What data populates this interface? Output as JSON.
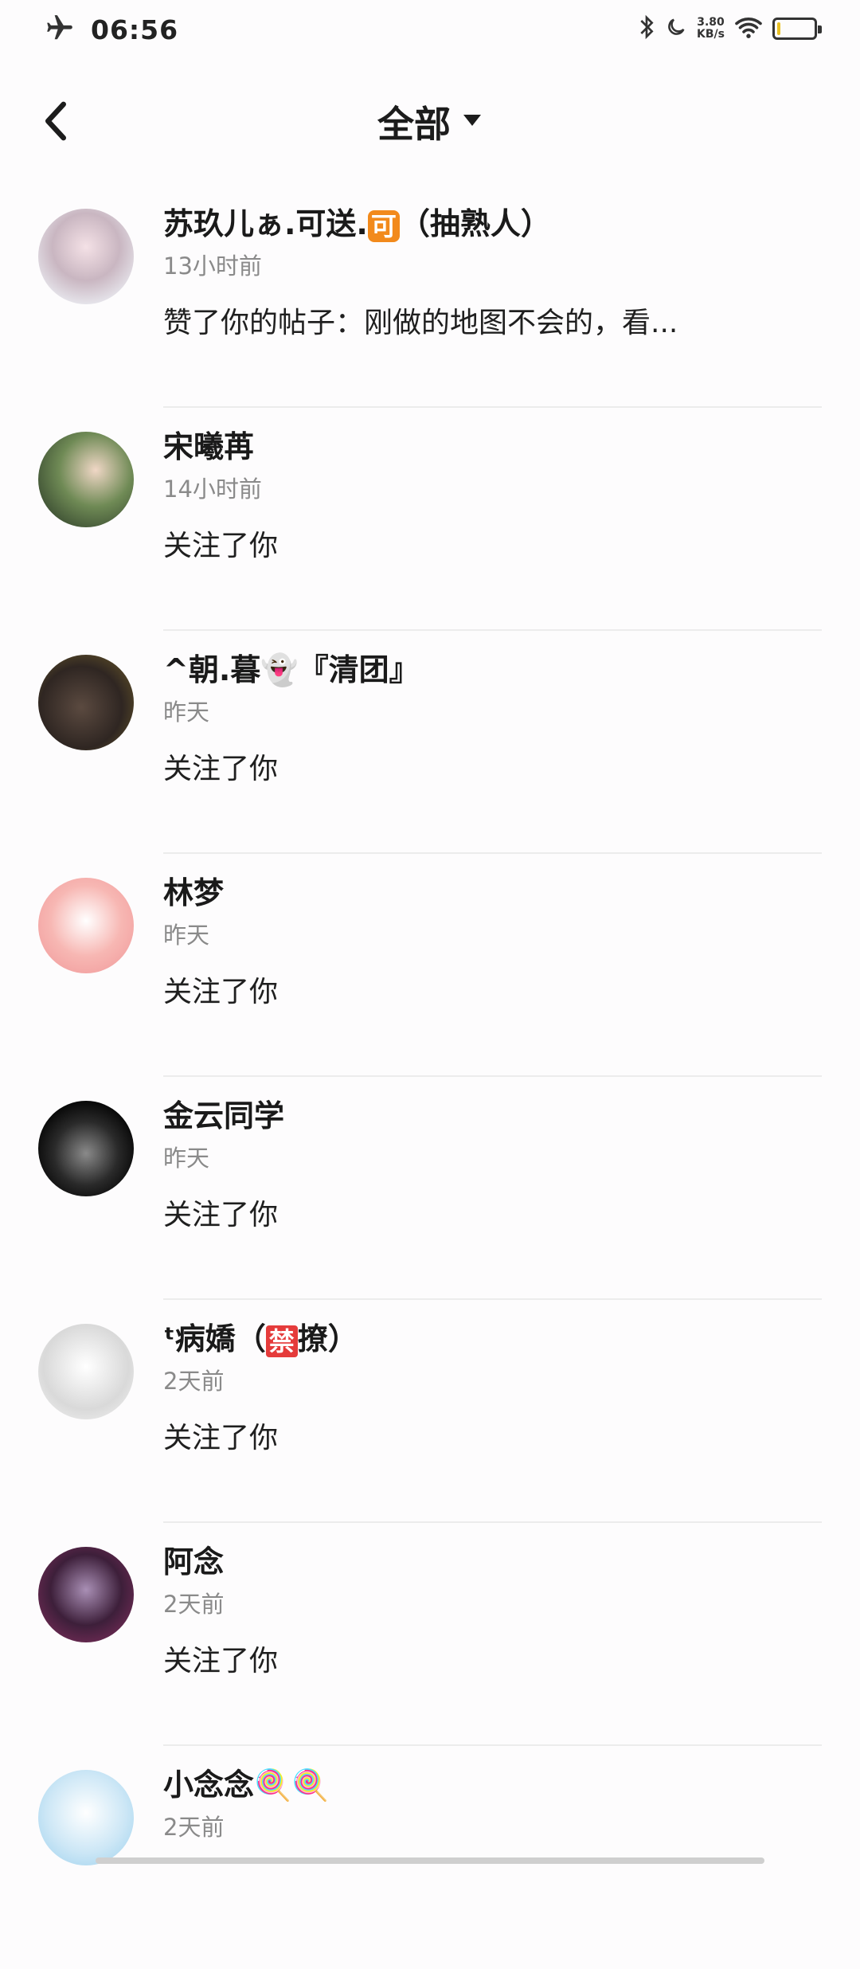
{
  "status_bar": {
    "time": "06:56",
    "net_speed_value": "3.80",
    "net_speed_unit": "KB/s",
    "battery_level_percent": 10,
    "icons": [
      "airplane-icon",
      "bluetooth-icon",
      "moon-icon",
      "wifi-icon",
      "battery-icon"
    ]
  },
  "header": {
    "title": "全部",
    "back_icon": "chevron-left-icon",
    "dropdown_icon": "caret-down-icon"
  },
  "notifications": [
    {
      "name": "苏玖儿ぁ.可送.",
      "badge": "可",
      "name_suffix": "（抽熟人）",
      "time": "13小时前",
      "message": "赞了你的帖子：刚做的地图不会的，看..."
    },
    {
      "name": "宋曦苒",
      "time": "14小时前",
      "message": "关注了你"
    },
    {
      "name": "^朝.暮👻『清团』",
      "time": "昨天",
      "message": "关注了你"
    },
    {
      "name": "林梦",
      "time": "昨天",
      "message": "关注了你"
    },
    {
      "name": "金云同学",
      "time": "昨天",
      "message": "关注了你"
    },
    {
      "name": "ᵗ病嬌（",
      "badge": "禁",
      "name_suffix": "撩）",
      "time": "2天前",
      "message": "关注了你"
    },
    {
      "name": "阿念",
      "time": "2天前",
      "message": "关注了你"
    },
    {
      "name": "小念念🍭🍭",
      "time": "2天前",
      "message": ""
    }
  ],
  "colors": {
    "background": "#fdfcfd",
    "divider": "#ececec",
    "badge_orange": "#f28a1c",
    "badge_red": "#e53b3b",
    "battery_fill": "#e9c023"
  }
}
